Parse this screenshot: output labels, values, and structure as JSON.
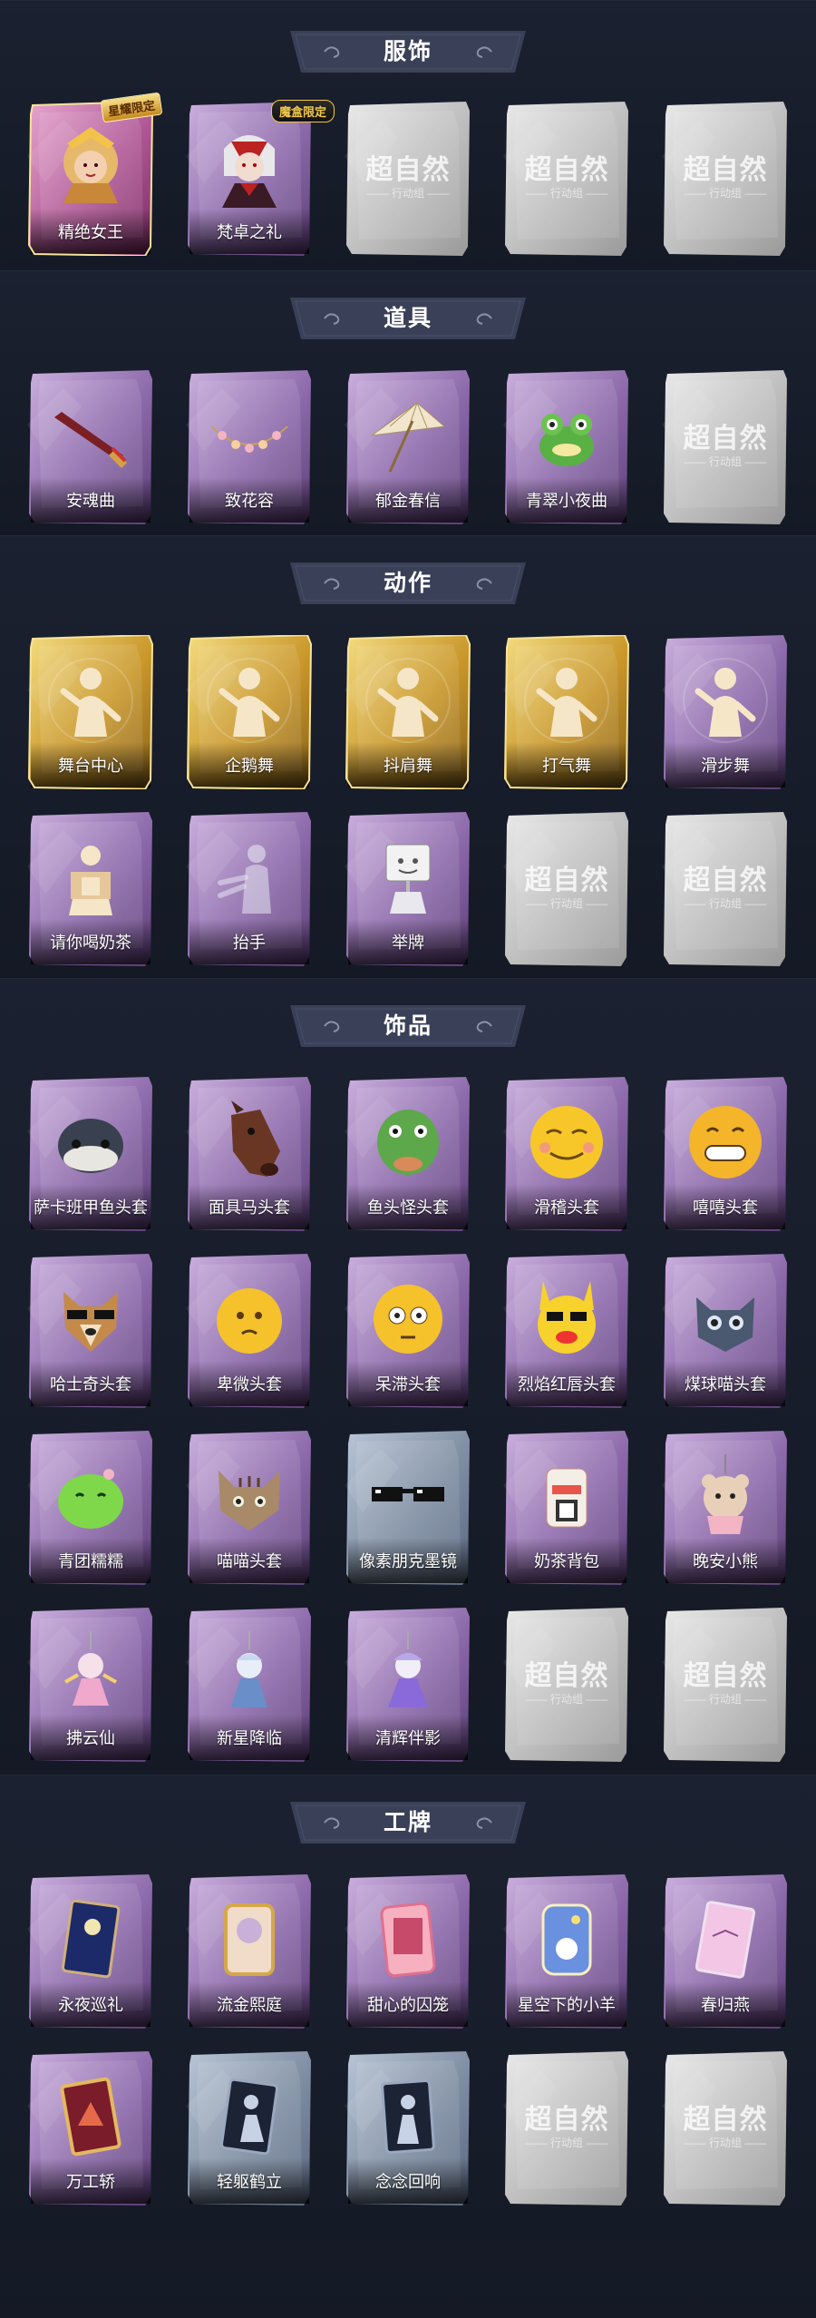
{
  "sections": [
    {
      "title": "服饰",
      "items": [
        {
          "label": "精绝女王",
          "bg": "pink",
          "art": "queen",
          "badge": "星耀限定"
        },
        {
          "label": "梵卓之礼",
          "bg": "purple",
          "art": "vampire",
          "badge2": "魔盒限定"
        },
        {
          "label": "",
          "bg": "grey",
          "art": "wm"
        },
        {
          "label": "",
          "bg": "grey",
          "art": "wm"
        },
        {
          "label": "",
          "bg": "grey",
          "art": "wm"
        }
      ]
    },
    {
      "title": "道具",
      "items": [
        {
          "label": "安魂曲",
          "bg": "purple",
          "art": "sword"
        },
        {
          "label": "致花容",
          "bg": "purple",
          "art": "garland"
        },
        {
          "label": "郁金春信",
          "bg": "purple",
          "art": "umbrella"
        },
        {
          "label": "青翠小夜曲",
          "bg": "purple",
          "art": "frog"
        },
        {
          "label": "",
          "bg": "grey",
          "art": "wm"
        }
      ]
    },
    {
      "title": "动作",
      "items": [
        {
          "label": "舞台中心",
          "bg": "gold",
          "art": "pose"
        },
        {
          "label": "企鹅舞",
          "bg": "gold",
          "art": "pose"
        },
        {
          "label": "抖肩舞",
          "bg": "gold",
          "art": "pose"
        },
        {
          "label": "打气舞",
          "bg": "gold",
          "art": "pose"
        },
        {
          "label": "滑步舞",
          "bg": "purple",
          "art": "pose"
        },
        {
          "label": "请你喝奶茶",
          "bg": "purple",
          "art": "tea"
        },
        {
          "label": "抬手",
          "bg": "purple",
          "art": "ghost"
        },
        {
          "label": "举牌",
          "bg": "purple",
          "art": "sign"
        },
        {
          "label": "",
          "bg": "grey",
          "art": "wm"
        },
        {
          "label": "",
          "bg": "grey",
          "art": "wm"
        }
      ]
    },
    {
      "title": "饰品",
      "items": [
        {
          "label": "萨卡班甲鱼头套",
          "bg": "purple",
          "art": "fish"
        },
        {
          "label": "面具马头套",
          "bg": "purple",
          "art": "horse"
        },
        {
          "label": "鱼头怪头套",
          "bg": "purple",
          "art": "fishman"
        },
        {
          "label": "滑稽头套",
          "bg": "purple",
          "art": "funny"
        },
        {
          "label": "嘻嘻头套",
          "bg": "purple",
          "art": "grin"
        },
        {
          "label": "哈士奇头套",
          "bg": "purple",
          "art": "dog"
        },
        {
          "label": "卑微头套",
          "bg": "purple",
          "art": "humble"
        },
        {
          "label": "呆滞头套",
          "bg": "purple",
          "art": "dull"
        },
        {
          "label": "烈焰红唇头套",
          "bg": "purple",
          "art": "pika"
        },
        {
          "label": "煤球喵头套",
          "bg": "purple",
          "art": "cat"
        },
        {
          "label": "青团糯糯",
          "bg": "purple",
          "art": "qingtuan"
        },
        {
          "label": "喵喵头套",
          "bg": "purple",
          "art": "tabby"
        },
        {
          "label": "像素朋克墨镜",
          "bg": "blue",
          "art": "shades"
        },
        {
          "label": "奶茶背包",
          "bg": "purple",
          "art": "bag"
        },
        {
          "label": "晚安小熊",
          "bg": "purple",
          "art": "bear"
        },
        {
          "label": "拂云仙",
          "bg": "purple",
          "art": "charm"
        },
        {
          "label": "新星降临",
          "bg": "purple",
          "art": "charm2"
        },
        {
          "label": "清辉伴影",
          "bg": "purple",
          "art": "charm3"
        },
        {
          "label": "",
          "bg": "grey",
          "art": "wm"
        },
        {
          "label": "",
          "bg": "grey",
          "art": "wm"
        }
      ]
    },
    {
      "title": "工牌",
      "items": [
        {
          "label": "永夜巡礼",
          "bg": "purple",
          "art": "frame-night"
        },
        {
          "label": "流金熙庭",
          "bg": "purple",
          "art": "frame-gold"
        },
        {
          "label": "甜心的囚笼",
          "bg": "purple",
          "art": "frame-pink"
        },
        {
          "label": "星空下的小羊",
          "bg": "purple",
          "art": "frame-sky"
        },
        {
          "label": "春归燕",
          "bg": "purple",
          "art": "frame-spring"
        },
        {
          "label": "万工轿",
          "bg": "purple",
          "art": "frame-red"
        },
        {
          "label": "轻躯鹤立",
          "bg": "blue",
          "art": "frame-sil"
        },
        {
          "label": "念念回响",
          "bg": "blue",
          "art": "frame-sil2"
        },
        {
          "label": "",
          "bg": "grey",
          "art": "wm"
        },
        {
          "label": "",
          "bg": "grey",
          "art": "wm"
        }
      ]
    }
  ],
  "watermark": {
    "title": "超自然",
    "sub": "—— 行动组 ——"
  },
  "colors": {
    "purple": "#a98ac4",
    "pink": "#c77ab0",
    "gold": "#d4aa3a",
    "blue": "#8a98aa",
    "grey": "#c4c4c4",
    "banner": "#3a4058"
  }
}
